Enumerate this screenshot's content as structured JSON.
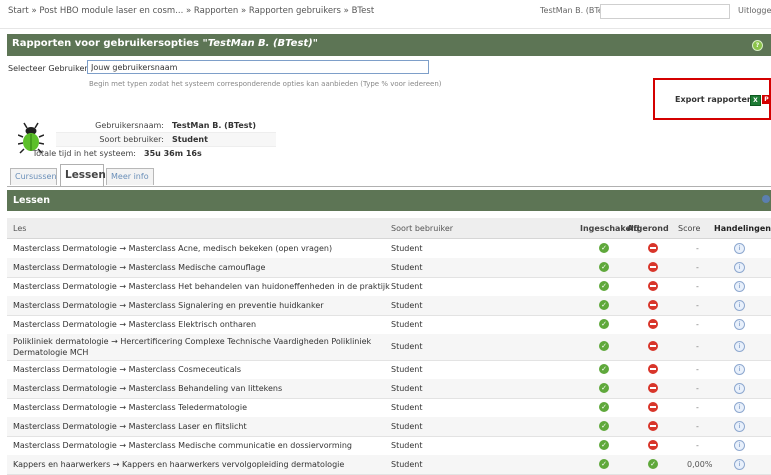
{
  "breadcrumb": "Start » Post HBO module laser en cosm... » Rapporten » Rapporten gebruikers » BTest",
  "user_menu": "TestMan B. (BTest)",
  "logout": "Uitlogge",
  "panel": {
    "title_prefix": "Rapporten voor gebruikersopties",
    "title_user": "\"TestMan B. (BTest)\""
  },
  "select_user": {
    "label": "Selecteer Gebruiker:",
    "value": "Jouw gebruikersnaam",
    "hint": "Begin met typen zodat het systeem corresponderende opties kan aanbieden (Type % voor iedereen)"
  },
  "export": {
    "label": "Export rapporten:",
    "xls_icon": "excel-icon",
    "pdf_icon": "pdf-icon"
  },
  "user_info": {
    "username_label": "Gebruikersnaam:",
    "username": "TestMan B. (BTest)",
    "type_label": "Soort bebruiker:",
    "type": "Student",
    "time_label": "Totale tijd in het systeem:",
    "time": "35u 36m 16s"
  },
  "tabs": [
    "Cursussen",
    "Lessen",
    "Meer info"
  ],
  "lessons": {
    "header": "Lessen",
    "columns": {
      "les": "Les",
      "soort": "Soort bebruiker",
      "ingeschakeld": "Ingeschakeld",
      "afgerond": "Afgerond",
      "score": "Score",
      "handelingen": "Handelingen"
    },
    "rows": [
      {
        "les": "Masterclass Dermatologie → Masterclass Acne, medisch bekeken (open vragen)",
        "soort": "Student",
        "afgerond": false,
        "score": "-"
      },
      {
        "les": "Masterclass Dermatologie → Masterclass Medische camouflage",
        "soort": "Student",
        "afgerond": false,
        "score": "-"
      },
      {
        "les": "Masterclass Dermatologie → Masterclass Het behandelen van huidoneffenheden in de praktijk",
        "soort": "Student",
        "afgerond": false,
        "score": "-"
      },
      {
        "les": "Masterclass Dermatologie → Masterclass Signalering en preventie huidkanker",
        "soort": "Student",
        "afgerond": false,
        "score": "-"
      },
      {
        "les": "Masterclass Dermatologie → Masterclass Elektrisch ontharen",
        "soort": "Student",
        "afgerond": false,
        "score": "-"
      },
      {
        "les": "Polikliniek dermatologie → Hercertificering Complexe Technische Vaardigheden Polikliniek Dermatologie MCH",
        "soort": "Student",
        "afgerond": false,
        "score": "-"
      },
      {
        "les": "Masterclass Dermatologie → Masterclass Cosmeceuticals",
        "soort": "Student",
        "afgerond": false,
        "score": "-"
      },
      {
        "les": "Masterclass Dermatologie → Masterclass Behandeling van littekens",
        "soort": "Student",
        "afgerond": false,
        "score": "-"
      },
      {
        "les": "Masterclass Dermatologie → Masterclass Teledermatologie",
        "soort": "Student",
        "afgerond": false,
        "score": "-"
      },
      {
        "les": "Masterclass Dermatologie → Masterclass Laser en flitslicht",
        "soort": "Student",
        "afgerond": false,
        "score": "-"
      },
      {
        "les": "Masterclass Dermatologie → Masterclass Medische communicatie en dossiervorming",
        "soort": "Student",
        "afgerond": false,
        "score": "-"
      },
      {
        "les": "Kappers en haarwerkers → Kappers en haarwerkers vervolgopleiding dermatologie",
        "soort": "Student",
        "afgerond": true,
        "score": "0,00%"
      }
    ]
  },
  "colors": {
    "header_green": "#5d7555",
    "ok_green": "#5fa83b",
    "no_red": "#d8352a",
    "export_border": "#d40000"
  }
}
